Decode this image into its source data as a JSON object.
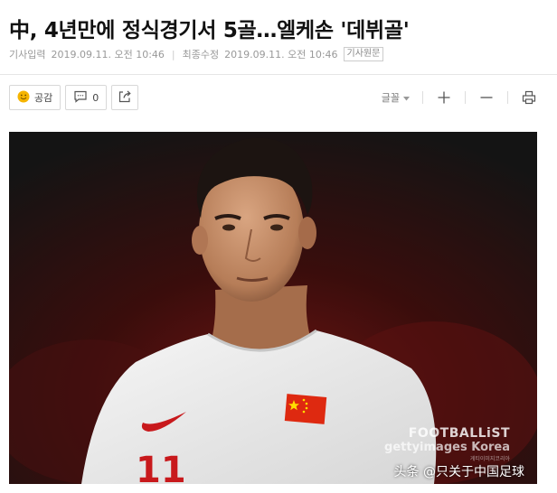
{
  "article": {
    "headline": "中, 4년만에 정식경기서 5골…엘케손 '데뷔골'",
    "meta": {
      "input_label": "기사입력",
      "input_date": "2019.09.11. 오전 10:46",
      "modified_label": "최종수정",
      "modified_date": "2019.09.11. 오전 10:46",
      "original_label": "기사원문"
    }
  },
  "toolbar": {
    "like_label": "공감",
    "comment_count": "0",
    "font_label": "글꼴"
  },
  "photo": {
    "watermark_brand": "FOOTBALLiST",
    "watermark_agency": "gettyimages Korea",
    "watermark_small": "게티이미지코리아",
    "credit": "头条 @只关于中国足球",
    "jersey_number": "11"
  },
  "colors": {
    "background": "#ffffff",
    "meta_text": "#999999",
    "jersey": "#efefef",
    "flag_red": "#de2910",
    "flag_star": "#ffde00"
  }
}
